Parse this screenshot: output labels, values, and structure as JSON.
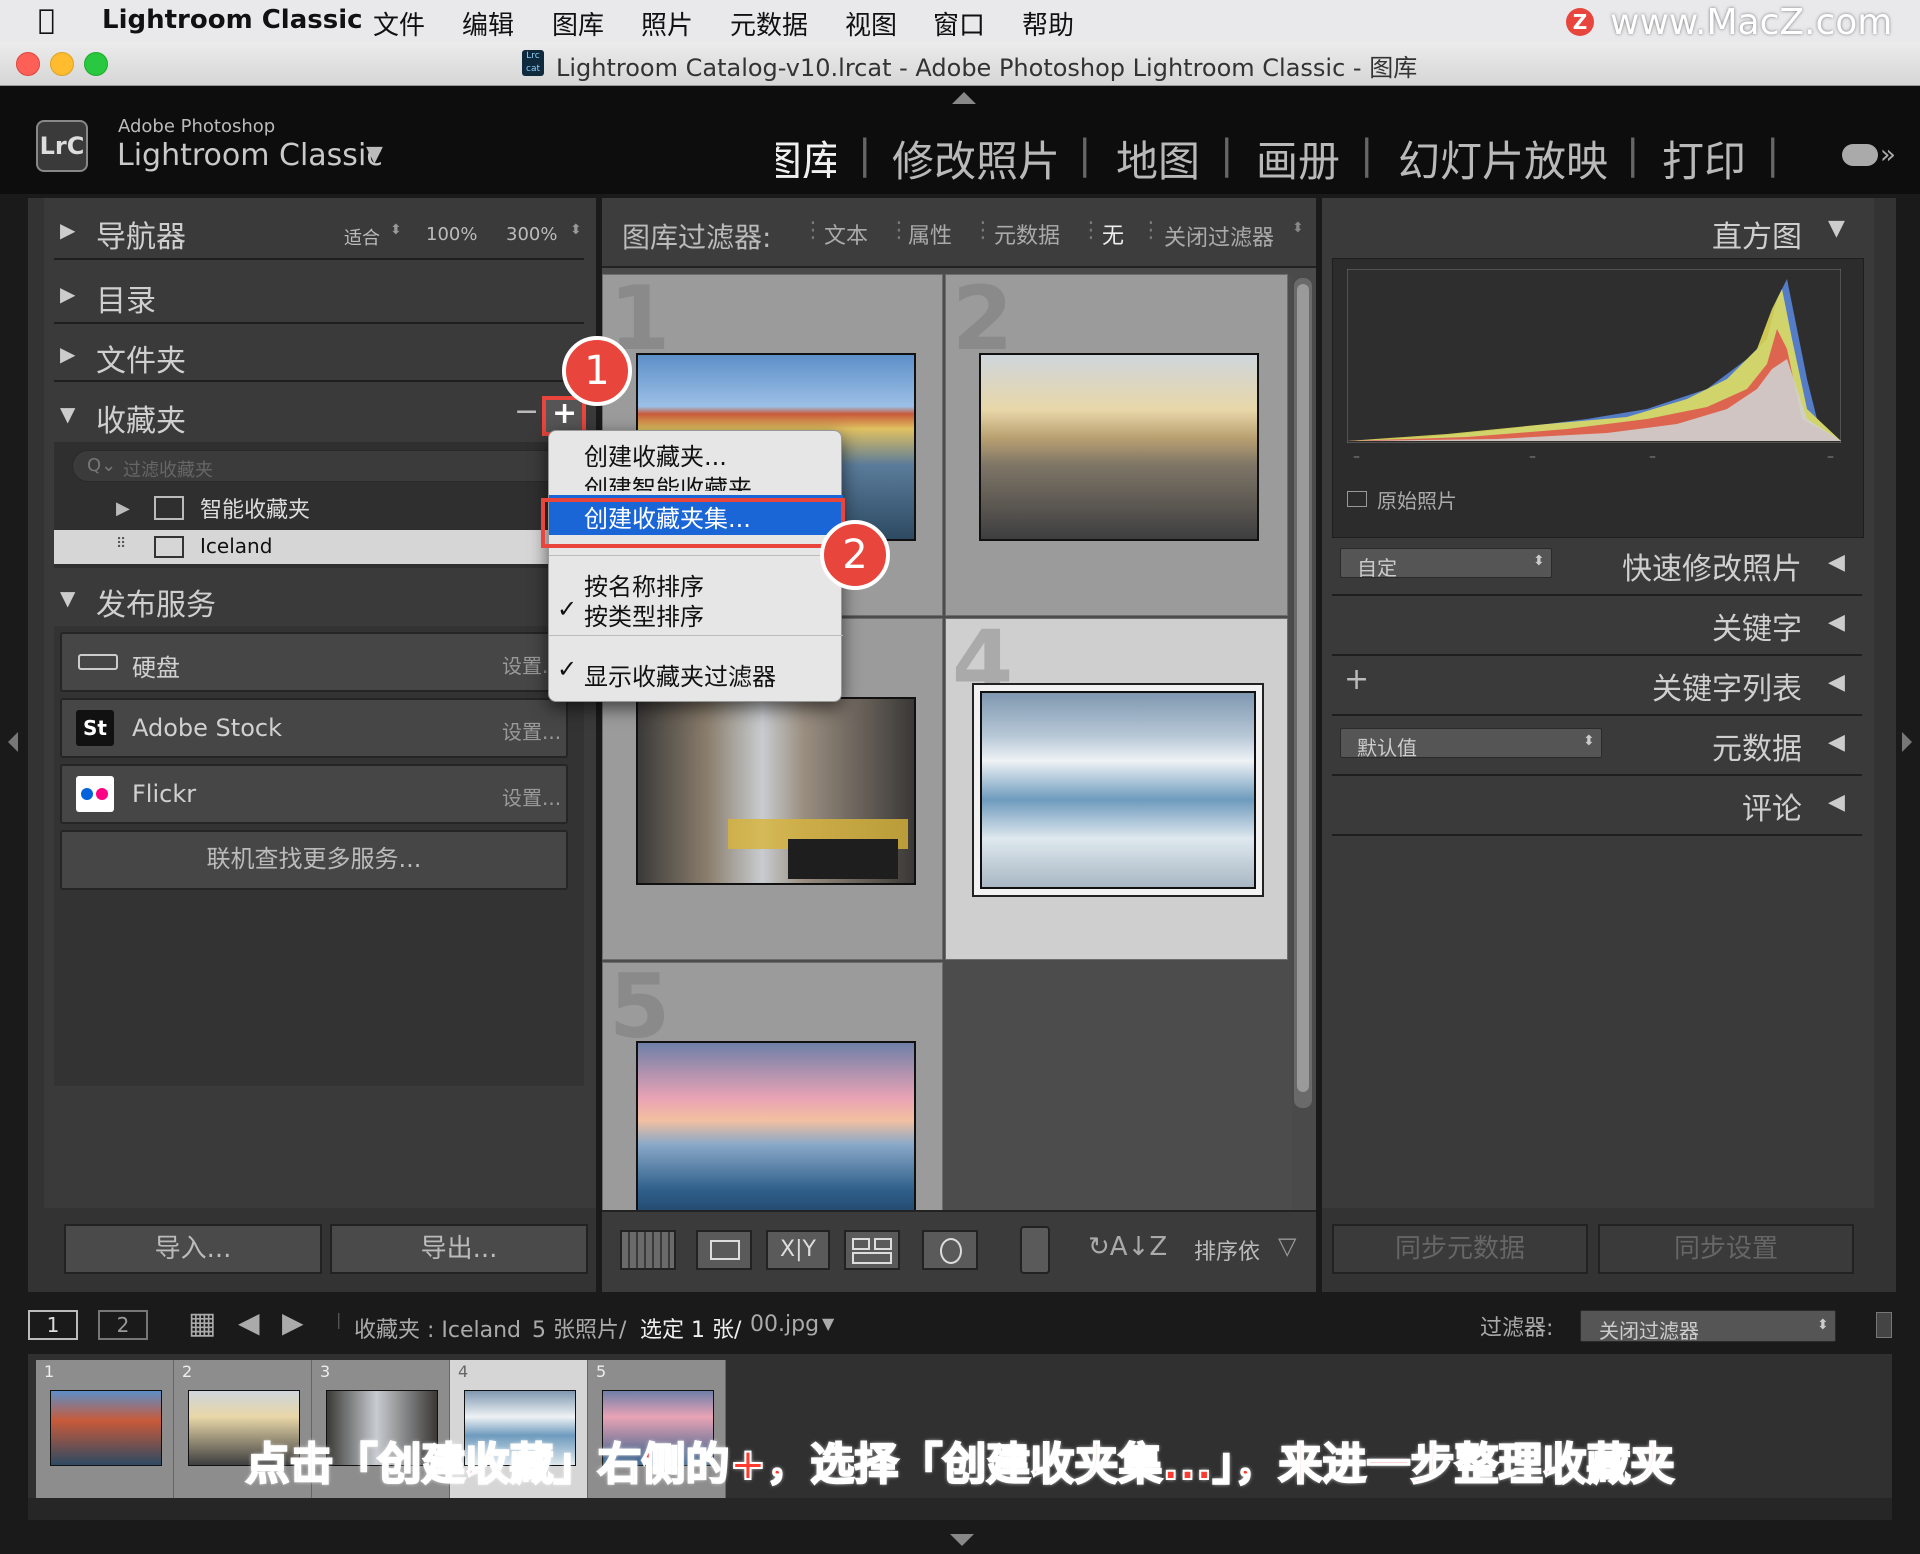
{
  "menubar": {
    "app_name": "Lightroom Classic",
    "items": [
      "文件",
      "编辑",
      "图库",
      "照片",
      "元数据",
      "视图",
      "窗口",
      "帮助"
    ],
    "watermark": "www.MacZ.com"
  },
  "window": {
    "title": "Lightroom Catalog-v10.lrcat - Adobe Photoshop Lightroom Classic - 图库"
  },
  "identity": {
    "logo": "LrC",
    "line1": "Adobe Photoshop",
    "line2": "Lightroom Classic",
    "caret": "▼"
  },
  "modules": [
    "图库",
    "修改照片",
    "地图",
    "画册",
    "幻灯片放映",
    "打印"
  ],
  "navigator": {
    "label": "导航器",
    "zoom": [
      "适合",
      "100%",
      "300%"
    ]
  },
  "left_panels": {
    "catalog": "目录",
    "folders": "文件夹",
    "collections": "收藏夹",
    "filter_placeholder": "过滤收藏夹",
    "smart_collections": "智能收藏夹",
    "iceland": "Iceland",
    "iceland_count": "5",
    "publish": "发布服务",
    "services": [
      {
        "name": "硬盘",
        "setup": "设置..."
      },
      {
        "name": "Adobe Stock",
        "setup": "设置..."
      },
      {
        "name": "Flickr",
        "setup": "设置..."
      }
    ],
    "more_services": "联机查找更多服务...",
    "import": "导入...",
    "export": "导出..."
  },
  "context_menu": {
    "items": [
      "创建收藏夹...",
      "创建智能收藏夹...",
      "创建收藏夹集...",
      "按名称排序",
      "按类型排序",
      "显示收藏夹过滤器"
    ],
    "checkmark": "✓"
  },
  "badges": [
    "1",
    "2"
  ],
  "filter_bar": {
    "label": "图库过滤器:",
    "options": [
      "文本",
      "属性",
      "元数据",
      "无"
    ],
    "close": "关闭过滤器"
  },
  "grid": {
    "cell_numbers": [
      "1",
      "2",
      "3",
      "4",
      "5"
    ]
  },
  "toolbar": {
    "sort_label": "排序依"
  },
  "right_panels": {
    "histogram": "直方图",
    "histogram_ticks": [
      "–",
      "–",
      "–",
      "–"
    ],
    "original_photo": "原始照片",
    "quick_develop": "快速修改照片",
    "quick_preset": "自定",
    "keywords": "关键字",
    "keyword_list": "关键字列表",
    "plus": "+",
    "metadata": "元数据",
    "metadata_preset": "默认值",
    "comments": "评论",
    "sync_metadata": "同步元数据",
    "sync_settings": "同步设置"
  },
  "filmstrip": {
    "screen1": "1",
    "screen2": "2",
    "source": "收藏夹 : Iceland",
    "count": "5 张照片/",
    "selected": "选定 1 张/",
    "file": "00.jpg",
    "filter_label": "过滤器:",
    "filter_value": "关闭过滤器",
    "thumb_numbers": [
      "1",
      "2",
      "3",
      "4",
      "5"
    ]
  },
  "caption": "点击「创建收藏」右侧的+，选择「创建收夹集...」，来进一步整理收藏夹",
  "colors": {
    "accent_red": "#e8453c",
    "menu_highlight": "#1a66d6",
    "caption_text": "#ff3b30"
  }
}
